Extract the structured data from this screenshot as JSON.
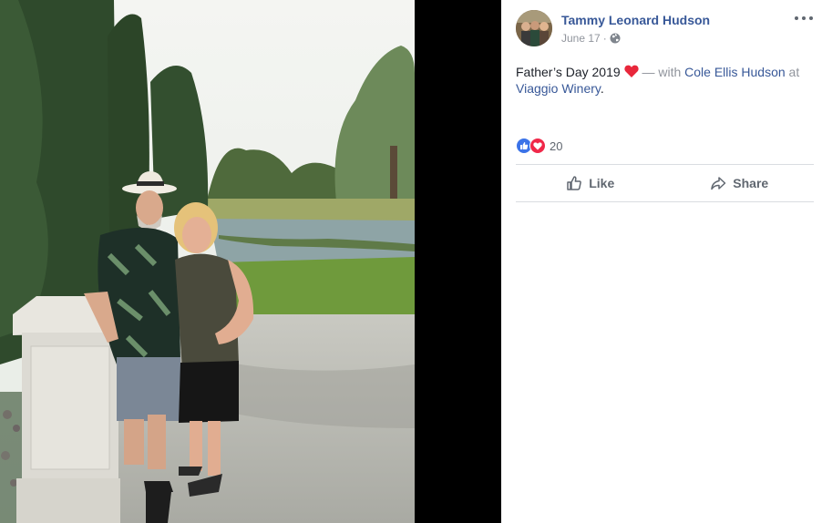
{
  "post": {
    "author_name": "Tammy Leonard Hudson",
    "date": "June 17",
    "separator": "·",
    "privacy_icon": "globe-icon",
    "more_icon": "more-options-icon",
    "caption": {
      "text": "Father’s Day 2019",
      "emoji": "heart-emoji",
      "with_prefix": "— with",
      "tagged_person": "Cole Ellis Hudson",
      "at_word": "at",
      "location": "Viaggio Winery",
      "end": "."
    },
    "reactions": {
      "icons": [
        "like-reaction-icon",
        "love-reaction-icon"
      ],
      "count": "20"
    },
    "actions": {
      "like_label": "Like",
      "share_label": "Share"
    }
  },
  "colors": {
    "link": "#385898",
    "meta": "#90949c",
    "like_blue": "#3b73e8",
    "love_red": "#f02849"
  }
}
